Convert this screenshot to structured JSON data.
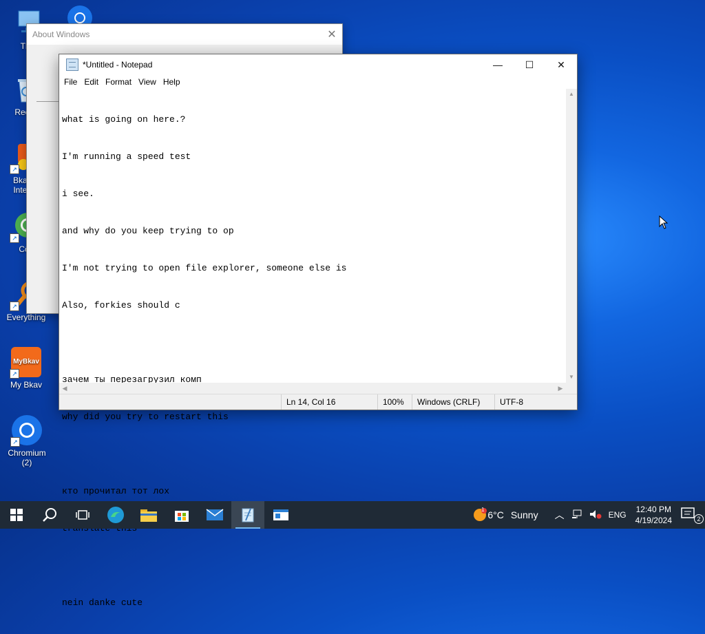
{
  "desktop": {
    "icons": [
      {
        "label": "This"
      },
      {
        "label": "Recyc"
      },
      {
        "label": "Bkav P Interne"
      },
      {
        "label": "Cốc"
      },
      {
        "label": "Everything"
      },
      {
        "label": "My Bkav",
        "badge": "MyBkav"
      },
      {
        "label": "Chromium (2)"
      }
    ]
  },
  "about_window": {
    "title": "About Windows",
    "close": "✕"
  },
  "notepad": {
    "title": "*Untitled - Notepad",
    "controls": {
      "minimize": "—",
      "maximize": "☐",
      "close": "✕"
    },
    "menu": [
      "File",
      "Edit",
      "Format",
      "View",
      "Help"
    ],
    "lines": [
      "what is going on here.?",
      "I'm running a speed test",
      "i see.",
      "and why do you keep trying to op",
      "I'm not trying to open file explorer, someone else is",
      "Also, forkies should c",
      "",
      "зачем ты перезагрузил комп",
      "why did you try to restart this",
      "",
      "кто прочитал тот лох",
      "translate this",
      "",
      "nein danke cute"
    ],
    "status": {
      "position": "Ln 14, Col 16",
      "zoom": "100%",
      "line_ending": "Windows (CRLF)",
      "encoding": "UTF-8"
    }
  },
  "taskbar": {
    "weather": {
      "temp": "6°C",
      "condition": "Sunny",
      "badge": "1"
    },
    "language": "ENG",
    "time": "12:40 PM",
    "date": "4/19/2024",
    "notifications": "2"
  },
  "colors": {
    "accent": "#0a4fc4",
    "taskbar": "#1f2a36"
  }
}
